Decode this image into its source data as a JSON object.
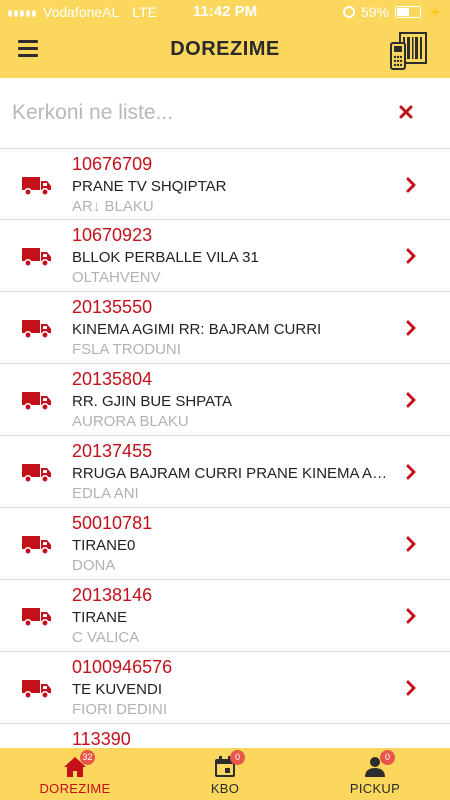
{
  "status_bar": {
    "carrier": "VodafoneAL",
    "network": "LTE",
    "time": "11:42 PM",
    "battery": "59%",
    "battery_level": 0.59
  },
  "header": {
    "title": "DOREZIME",
    "menu_icon": "hamburger-menu-icon",
    "scan_icon": "barcode-scanner-icon"
  },
  "search": {
    "placeholder": "Kerkoni ne liste...",
    "value": "",
    "clear_icon": "close-icon"
  },
  "colors": {
    "header_bg": "#fbd75e",
    "accent_red": "#c4101a",
    "badge": "#e8564a"
  },
  "deliveries": [
    {
      "code": "10676709",
      "address": "PRANE TV SHQIPTAR",
      "extra": "AR↓ BLAKU"
    },
    {
      "code": "10670923",
      "address": "BLLOK PERBALLE VILA 31",
      "extra": "OLTAHVENV"
    },
    {
      "code": "20135550",
      "address": "KINEMA AGIMI RR: BAJRAM CURRI",
      "extra": "FSLA TRODUNI"
    },
    {
      "code": "20135804",
      "address": "RR. GJIN BUE SHPATA",
      "extra": "AURORA BLAKU"
    },
    {
      "code": "20137455",
      "address": "RRUGA BAJRAM CURRI PRANE KINEMA AGIMI",
      "extra": "EDLA ANI"
    },
    {
      "code": "50010781",
      "address": "TIRANE0",
      "extra": "DONA"
    },
    {
      "code": "20138146",
      "address": "TIRANE",
      "extra": "C VALICA"
    },
    {
      "code": "0100946576",
      "address": "TE KUVENDI",
      "extra": "FIORI DEDINI"
    },
    {
      "code": "113390",
      "address": "",
      "extra": ""
    }
  ],
  "tabs": [
    {
      "label": "DOREZIME",
      "badge": "32",
      "icon": "home-icon",
      "active": true
    },
    {
      "label": "KBO",
      "badge": "0",
      "icon": "calendar-icon",
      "active": false
    },
    {
      "label": "PICKUP",
      "badge": "0",
      "icon": "person-icon",
      "active": false
    }
  ]
}
